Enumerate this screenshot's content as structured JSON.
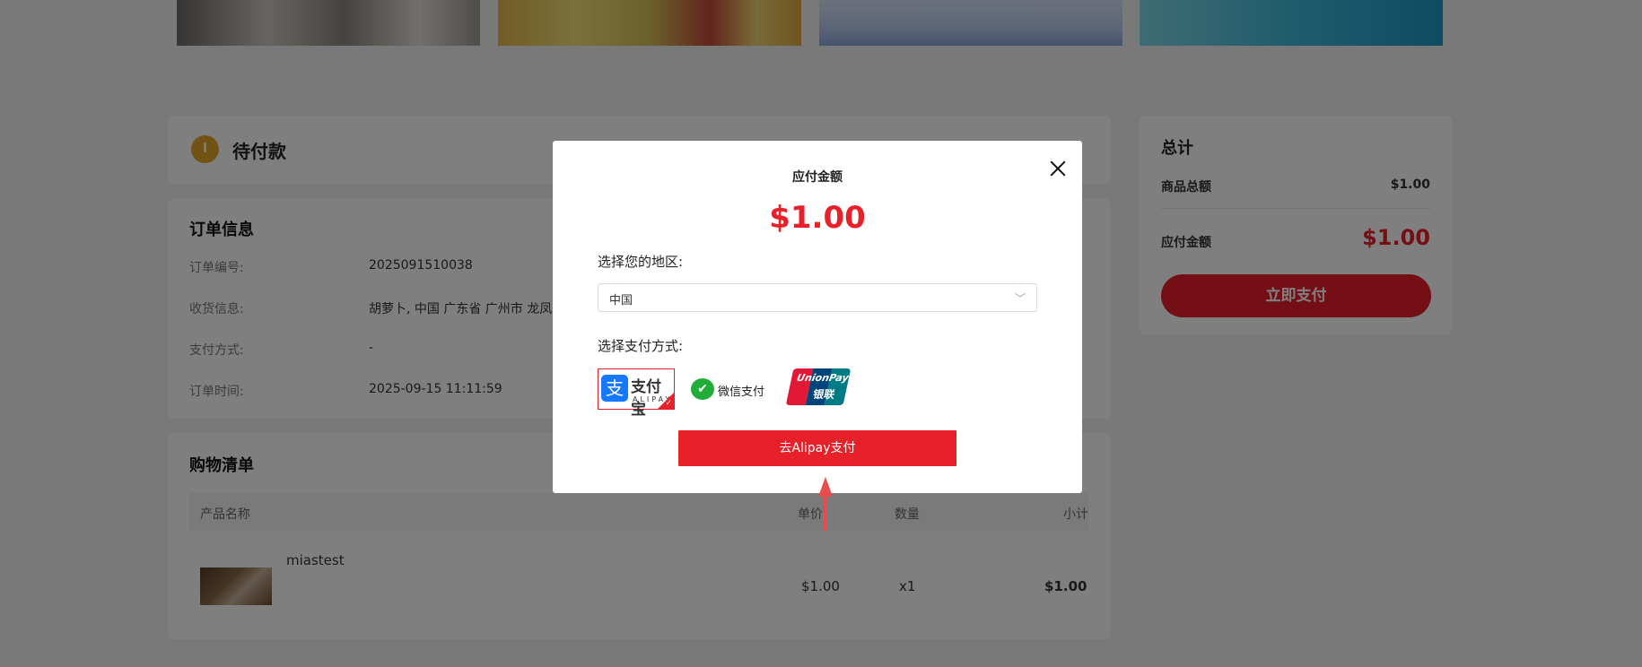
{
  "status": {
    "icon": "clock-icon",
    "icon_glyph": "l",
    "text": "待付款"
  },
  "order": {
    "title": "订单信息",
    "rows": [
      {
        "label": "订单编号:",
        "value": "2025091510038"
      },
      {
        "label": "收货信息:",
        "value": "胡萝卜, 中国 广东省 广州市 龙凤"
      },
      {
        "label": "支付方式:",
        "value": "-"
      },
      {
        "label": "订单时间:",
        "value": "2025-09-15 11:11:59"
      }
    ]
  },
  "cart": {
    "title": "购物清单",
    "headers": [
      "产品名称",
      "单价",
      "数量",
      "小计"
    ],
    "items": [
      {
        "name": "miastest",
        "price": "$1.00",
        "qty": "x1",
        "subtotal": "$1.00"
      }
    ]
  },
  "summary": {
    "title": "总计",
    "goods_total_label": "商品总额",
    "goods_total": "$1.00",
    "payable_label": "应付金额",
    "payable": "$1.00",
    "pay_button": "立即支付"
  },
  "modal": {
    "amount_label": "应付金额",
    "amount": "$1.00",
    "region_label": "选择您的地区:",
    "region_value": "中国",
    "method_label": "选择支付方式:",
    "methods": [
      {
        "name": "alipay",
        "logo_text": "支付宝",
        "logo_sub": "ALIPAY",
        "glyph": "支",
        "selected": true
      },
      {
        "name": "wechat",
        "logo_text": "微信支付",
        "glyph": "✔",
        "selected": false
      },
      {
        "name": "unionpay",
        "logo_text": "UnionPay",
        "logo_sub": "银联",
        "selected": false
      }
    ],
    "go_pay_button": "去Alipay支付",
    "close_icon": "close-icon"
  },
  "colors": {
    "accent": "#e8202a",
    "status_icon": "#e3a72a",
    "alipay": "#1677ff",
    "wechat": "#22ac38"
  }
}
